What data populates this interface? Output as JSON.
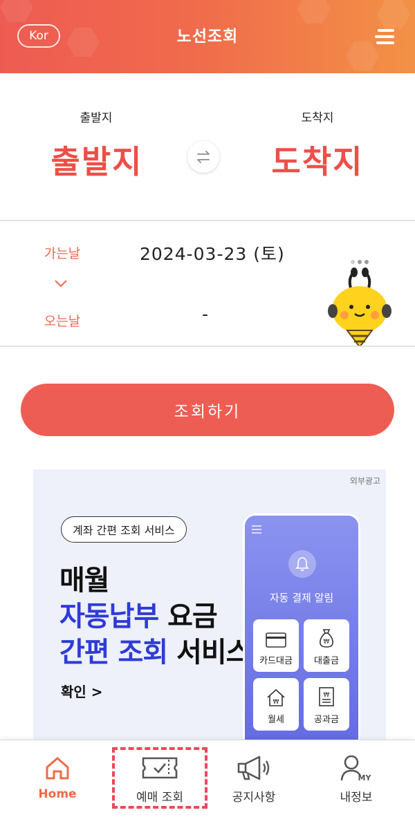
{
  "header": {
    "lang_button": "Kor",
    "title": "노선조회",
    "menu_icon": "hamburger-menu-icon"
  },
  "route": {
    "departure_label": "출발지",
    "departure_value": "출발지",
    "arrival_label": "도착지",
    "arrival_value": "도착지",
    "swap_icon": "swap-arrows-icon"
  },
  "dates": {
    "outbound_label": "가는날",
    "outbound_value": "2024-03-23 (토)",
    "return_label": "오는날",
    "return_value": "-",
    "toggle_icon": "chevron-down-icon"
  },
  "search_button": "조회하기",
  "ad": {
    "tag": "외부광고",
    "pill": "계좌 간편 조회 서비스",
    "headline_line1": "매월",
    "headline_line2_blue": "자동납부",
    "headline_line2_black": " 요금",
    "headline_line3_blue": "간편 조회",
    "headline_line3_black": " 서비스",
    "confirm": "확인 >",
    "phone_title": "자동 결제 알림",
    "tiles": [
      {
        "label": "카드대금",
        "icon": "card-icon"
      },
      {
        "label": "대출금",
        "icon": "money-bag-icon"
      },
      {
        "label": "월세",
        "icon": "house-icon"
      },
      {
        "label": "공과금",
        "icon": "bill-icon"
      }
    ]
  },
  "bottom_nav": {
    "items": [
      {
        "label": "Home",
        "icon": "home-icon",
        "active": true
      },
      {
        "label": "예매 조회",
        "icon": "ticket-icon",
        "active": false
      },
      {
        "label": "공지사항",
        "icon": "megaphone-icon",
        "active": false
      },
      {
        "label": "내정보",
        "icon": "user-my-icon",
        "active": false
      }
    ]
  },
  "colors": {
    "accent": "#ee5d53",
    "header_gradient_start": "#ee5b52",
    "header_gradient_end": "#f29146",
    "route_text": "#ee4f48",
    "date_label": "#f0664c",
    "ad_blue": "#2f3bd6",
    "highlight": "#ee4759"
  }
}
